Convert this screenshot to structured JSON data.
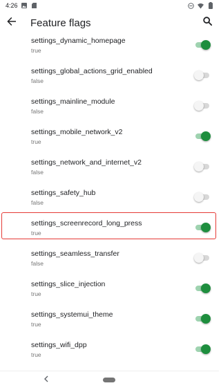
{
  "status_bar": {
    "time": "4:26"
  },
  "app_bar": {
    "title": "Feature flags"
  },
  "flags": [
    {
      "name": "settings_dynamic_homepage",
      "value": "true",
      "enabled": true
    },
    {
      "name": "settings_global_actions_grid_enabled",
      "value": "false",
      "enabled": false
    },
    {
      "name": "settings_mainline_module",
      "value": "false",
      "enabled": false
    },
    {
      "name": "settings_mobile_network_v2",
      "value": "true",
      "enabled": true
    },
    {
      "name": "settings_network_and_internet_v2",
      "value": "false",
      "enabled": false
    },
    {
      "name": "settings_safety_hub",
      "value": "false",
      "enabled": false
    },
    {
      "name": "settings_screenrecord_long_press",
      "value": "true",
      "enabled": true
    },
    {
      "name": "settings_seamless_transfer",
      "value": "false",
      "enabled": false
    },
    {
      "name": "settings_slice_injection",
      "value": "true",
      "enabled": true
    },
    {
      "name": "settings_systemui_theme",
      "value": "true",
      "enabled": true
    },
    {
      "name": "settings_wifi_dpp",
      "value": "true",
      "enabled": true
    }
  ],
  "icons": {
    "back": "arrow-back-icon",
    "search": "search-icon",
    "nav_back": "chevron-left-icon"
  },
  "colors": {
    "toggle_on_thumb": "#1e8e3e",
    "toggle_on_track": "#9fd3b0",
    "highlight": "#e53935"
  }
}
